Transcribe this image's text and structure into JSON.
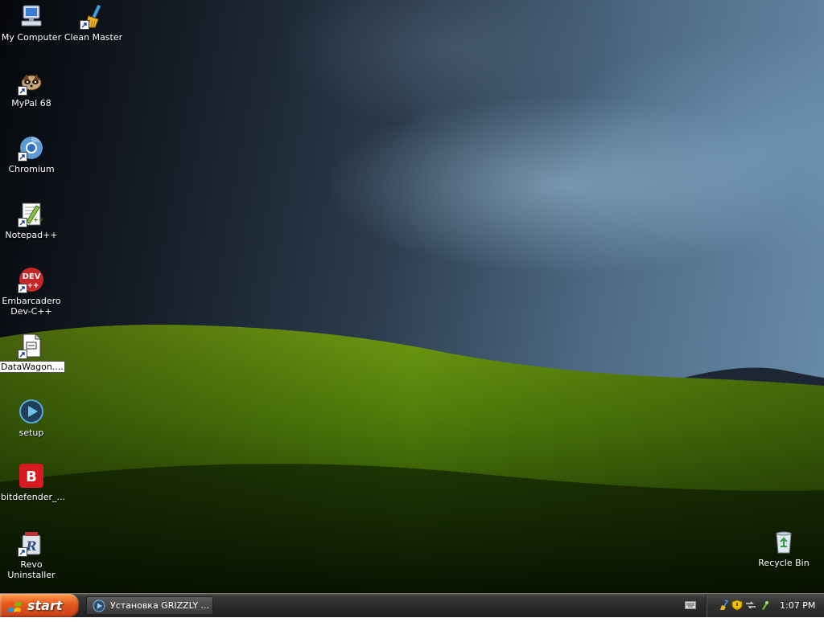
{
  "desktop": {
    "icons": [
      {
        "label": "My Computer",
        "icon": "my-computer-icon",
        "shortcut": false
      },
      {
        "label": "Clean Master",
        "icon": "broom-icon",
        "shortcut": true
      },
      {
        "label": "MyPal 68",
        "icon": "raccoon-icon",
        "shortcut": true
      },
      {
        "label": "Chromium",
        "icon": "chromium-icon",
        "shortcut": true
      },
      {
        "label": "Notepad++",
        "icon": "notepad-plus-plus-icon",
        "shortcut": true
      },
      {
        "label": "Embarcadero Dev-C++",
        "icon": "devcpp-icon",
        "shortcut": true
      },
      {
        "label": "DataWagon....",
        "icon": "document-icon",
        "shortcut": true,
        "selected": true
      },
      {
        "label": "setup",
        "icon": "play-icon",
        "shortcut": false
      },
      {
        "label": "bitdefender_...",
        "icon": "bitdefender-icon",
        "shortcut": false
      },
      {
        "label": "Revo Uninstaller",
        "icon": "revo-uninstaller-icon",
        "shortcut": true
      },
      {
        "label": "Recycle Bin",
        "icon": "recycle-bin-icon",
        "shortcut": false
      }
    ]
  },
  "taskbar": {
    "start_label": "start",
    "task_item": {
      "label": "Установка GRIZZLY ...",
      "icon": "setup-disc-icon"
    },
    "tray": {
      "icons": [
        "keyboard-icon",
        "broom-icon",
        "security-shield-icon",
        "network-icon",
        "safely-remove-icon"
      ],
      "clock": "1:07 PM"
    }
  },
  "colors": {
    "start_button": "#e4571d",
    "taskbar": "#2b2b2b",
    "selection": "#ffffff"
  }
}
